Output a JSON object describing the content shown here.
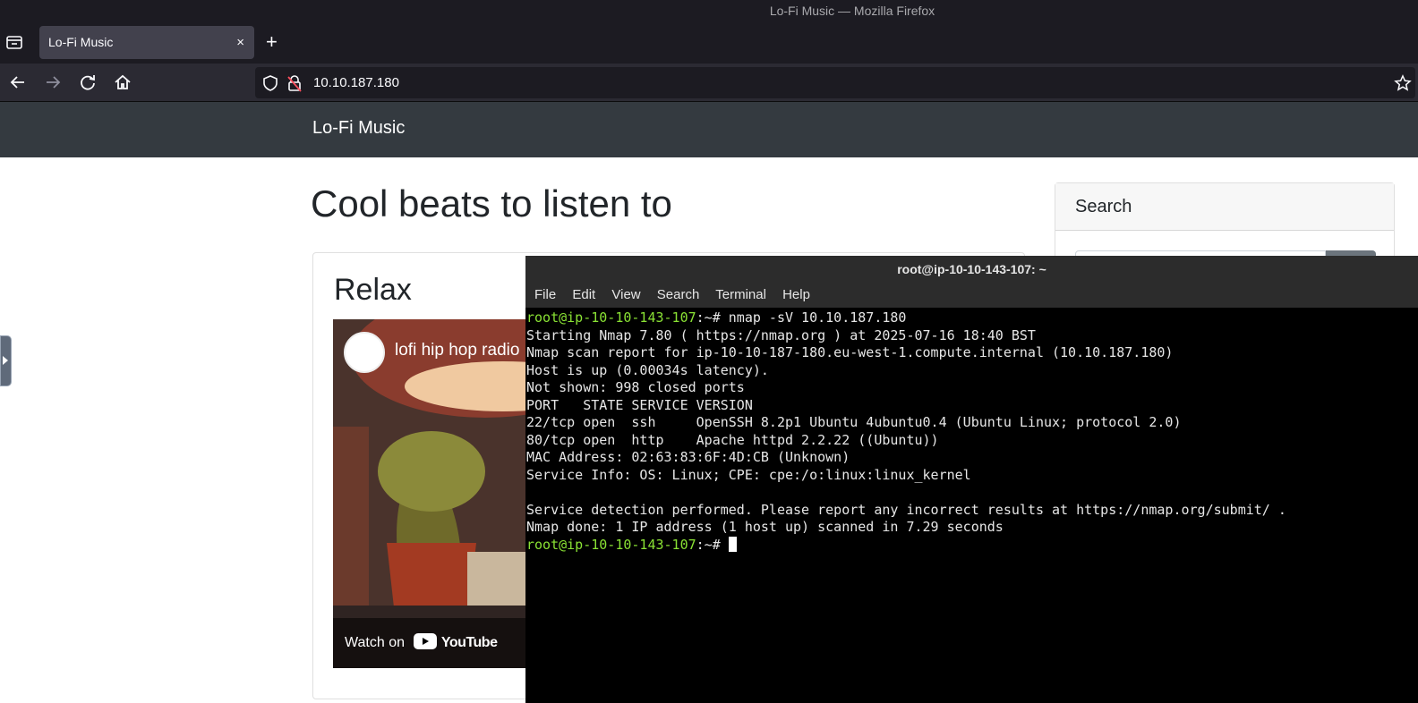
{
  "window": {
    "title": "Lo-Fi Music — Mozilla Firefox"
  },
  "browser": {
    "tab": {
      "label": "Lo-Fi Music",
      "close": "×"
    },
    "new_tab": "+",
    "url": "10.10.187.180"
  },
  "site": {
    "brand": "Lo-Fi Music",
    "heading": "Cool beats to listen to",
    "card_title": "Relax",
    "video_title": "lofi hip hop radio",
    "watch_label": "Watch on",
    "youtube_label": "YouTube",
    "search_heading": "Search"
  },
  "terminal": {
    "title": "root@ip-10-10-143-107: ~",
    "menu": [
      "File",
      "Edit",
      "View",
      "Search",
      "Terminal",
      "Help"
    ],
    "prompt": "root@ip-10-10-143-107",
    "prompt_suffix": ":~# ",
    "command": "nmap -sV 10.10.187.180",
    "output": [
      "Starting Nmap 7.80 ( https://nmap.org ) at 2025-07-16 18:40 BST",
      "Nmap scan report for ip-10-10-187-180.eu-west-1.compute.internal (10.10.187.180)",
      "Host is up (0.00034s latency).",
      "Not shown: 998 closed ports",
      "PORT   STATE SERVICE VERSION",
      "22/tcp open  ssh     OpenSSH 8.2p1 Ubuntu 4ubuntu0.4 (Ubuntu Linux; protocol 2.0)",
      "80/tcp open  http    Apache httpd 2.2.22 ((Ubuntu))",
      "MAC Address: 02:63:83:6F:4D:CB (Unknown)",
      "Service Info: OS: Linux; CPE: cpe:/o:linux:linux_kernel",
      "",
      "Service detection performed. Please report any incorrect results at https://nmap.org/submit/ .",
      "Nmap done: 1 IP address (1 host up) scanned in 7.29 seconds"
    ]
  }
}
